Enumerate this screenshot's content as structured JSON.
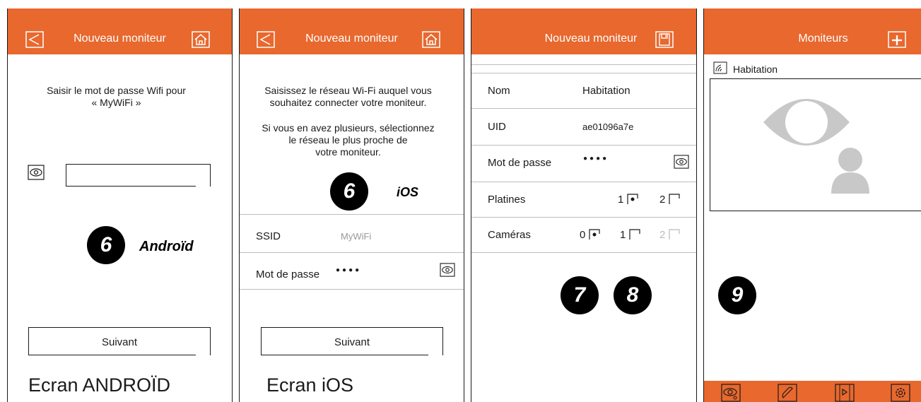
{
  "colors": {
    "accent": "#e8682e",
    "dark": "#1a1a1a",
    "grey": "#bdbdbd"
  },
  "panel1": {
    "title": "Nouveau moniteur",
    "icons": [
      "back-icon",
      "home-icon",
      "eye-icon"
    ],
    "prompt_line1": "Saisir le mot de passe Wifi pour",
    "prompt_line2": "« MyWiFi »",
    "password_value": "",
    "next_button": "Suivant",
    "step_number": "6",
    "step_label": "Androïd",
    "caption": "Ecran ANDROÏD"
  },
  "panel2": {
    "title": "Nouveau moniteur",
    "icons": [
      "back-icon",
      "home-icon",
      "eye-icon"
    ],
    "p1_line1": "Saisissez le réseau Wi-Fi auquel vous",
    "p1_line2": "souhaitez connecter votre moniteur.",
    "p2_line1": "Si vous en avez plusieurs, sélectionnez",
    "p2_line2": "le réseau le plus proche de",
    "p2_line3": "votre moniteur.",
    "step_number": "6",
    "step_label": "iOS",
    "ssid_label": "SSID",
    "ssid_value": "MyWiFi",
    "password_label": "Mot de passe",
    "password_value": "●●●●",
    "next_button": "Suivant",
    "caption": "Ecran iOS"
  },
  "panel3": {
    "title": "Nouveau moniteur",
    "icons": [
      "save-icon",
      "eye-icon",
      "checkbox-checked-icon",
      "checkbox-empty-icon"
    ],
    "name_label": "Nom",
    "name_value": "Habitation",
    "uid_label": "UID",
    "uid_value": "ae01096a7e",
    "password_label": "Mot de passe",
    "password_value": "●●●●",
    "platines_label": "Platines",
    "platine_1": "1",
    "platine_2": "2",
    "platines_selected": "1",
    "cameras_label": "Caméras",
    "camera_0": "0",
    "camera_1": "1",
    "camera_2": "2",
    "cameras_selected": "0",
    "step_a": "7",
    "step_b": "8"
  },
  "panel4": {
    "title": "Moniteurs",
    "icons": [
      "add-icon",
      "wifi-monitor-icon",
      "placeholder-avatar-icon",
      "monitor-view-icon",
      "phone-icon",
      "media-icon",
      "settings-icon"
    ],
    "monitor_name": "Habitation",
    "step_number": "9"
  }
}
